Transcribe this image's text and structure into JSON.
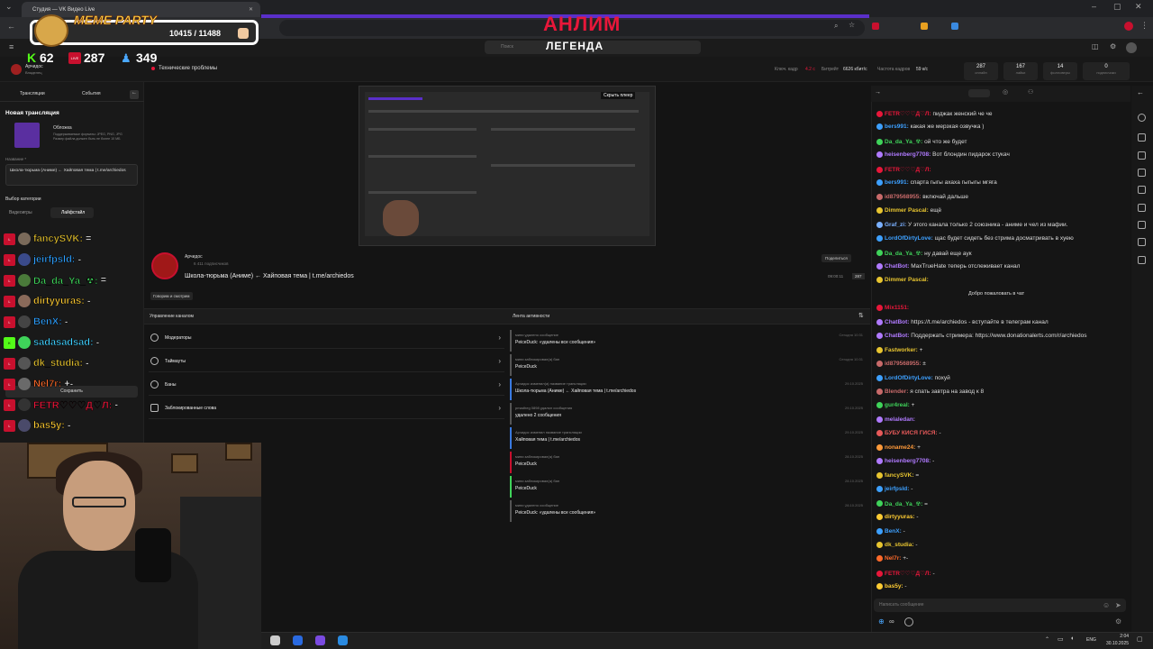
{
  "browser": {
    "tab_title": "Студия — VK Видео Live"
  },
  "overlay": {
    "title": "MEME PARTY",
    "counter": "10415 / 11488",
    "live_badge": "LIVE",
    "counts": {
      "kick": "62",
      "live": "287",
      "viewers": "349"
    },
    "brand": "АНЛИМ",
    "subtitle": "ЛЕГЕНДА"
  },
  "header": {
    "search_placeholder": "Поиск",
    "status_text": "Технические проблемы",
    "keyframe_label": "Ключ. кадр",
    "keyframe_value": "4.2 с",
    "bitrate_label": "Битрейт",
    "bitrate_value": "6626 кбит/с",
    "fps_label": "Частота кадров",
    "fps_value": "59 к/с",
    "stats": [
      {
        "v": "287",
        "l": "онлайн"
      },
      {
        "v": "167",
        "l": "лайки"
      },
      {
        "v": "14",
        "l": "фолловеры"
      },
      {
        "v": "0",
        "l": "подписчики"
      }
    ]
  },
  "profile": {
    "name": "Арчидос",
    "sub": "Владелец"
  },
  "left": {
    "tabs": [
      "Трансляции",
      "События"
    ],
    "new_stream": "Новая трансляция",
    "cover_label": "Обложка",
    "cover_hint": "Поддерживаемые форматы: JPEG, PNG, JPG Размер файла должен быть не более 10 МБ",
    "name_label": "Название *",
    "name_value": "Школа-тюрьма (Аниме) ← Хайповая тема | t.me/archiedos",
    "category_label": "Выбор категории",
    "cat_games": "Видеоигры",
    "cat_life": "Лайфстайл",
    "save_button": "Сохранить"
  },
  "viewers": [
    {
      "name": "fancySVK:",
      "msg": "=",
      "color": "#e8c530"
    },
    {
      "name": "jeirfpsld:",
      "msg": "-",
      "color": "#2ea0ff"
    },
    {
      "name": "Da_da_Ya_☢:",
      "msg": "=",
      "color": "#3fd35a"
    },
    {
      "name": "dirtyyuras:",
      "msg": "-",
      "color": "#ffcc33"
    },
    {
      "name": "BenX:",
      "msg": "-",
      "color": "#2ea0ff"
    },
    {
      "name": "sadasadsad:",
      "msg": "-",
      "color": "#40d0ff"
    },
    {
      "name": "dk_studia:",
      "msg": "-",
      "color": "#e8c530"
    },
    {
      "name": "Nel7r:",
      "msg": "+-",
      "color": "#ff6a2a"
    },
    {
      "name": "FETR♡♡♡Д♡Л:",
      "msg": "-",
      "color": "#e8173a"
    },
    {
      "name": "bas5y:",
      "msg": "-",
      "color": "#ffcc33"
    }
  ],
  "channel": {
    "name": "Арчидос",
    "subs": "6 411 подписчиков",
    "stream_title": "Школа-тюрьма (Аниме) ← Хайповая тема | t.me/archiedos",
    "category": "Говорим и смотрим",
    "share": "Поделиться",
    "time": "09:00:11",
    "viewers": "287",
    "hide_player": "Скрыть плеер"
  },
  "management": {
    "title": "Управление каналом",
    "items": [
      "Модераторы",
      "Таймауты",
      "Баны",
      "Заблокированные слова"
    ]
  },
  "activity": {
    "title": "Лента активности",
    "items": [
      {
        "t1": "мини удалено сообщение",
        "t2": "PeiceDuck: «удалены все сообщения»",
        "tm": "Сегодня 10:31"
      },
      {
        "t1": "мини заблокировал(а) бан",
        "t2": "PeiceDuck",
        "tm": "Сегодня 10:31"
      },
      {
        "t1": "Арчидос изменил(а) название трансляции",
        "t2": "Школа-тюрьма (Аниме) ← Хайповая тема | t.me/archiedos",
        "tm": "29.10.2025"
      },
      {
        "t1": "pmadheg 0898 удалил сообщения",
        "t2": "удалено 2 сообщения",
        "tm": "29.10.2025"
      },
      {
        "t1": "Арчидос изменил название трансляции",
        "t2": "Хайповая тема | t.me/archiedos",
        "tm": "29.10.2025"
      },
      {
        "t1": "мини заблокировал(а) бан",
        "t2": "PeiceDuck",
        "tm": "28.10.2025"
      },
      {
        "t1": "мини заблокировал(а) бан",
        "t2": "PeiceDuck",
        "tm": "28.10.2025"
      },
      {
        "t1": "мини удалено сообщение",
        "t2": "PeiceDuck: «удалены все сообщения»",
        "tm": "28.10.2025"
      }
    ]
  },
  "chat": {
    "lines": [
      {
        "u": "FETR♡♡♡Д♡Л:",
        "m": "пиджак женский че че",
        "c": "#e8173a"
      },
      {
        "u": "bers991:",
        "m": "какая же мерзкая озвучка )",
        "c": "#3da0ff"
      },
      {
        "u": "Da_da_Ya_☢:",
        "m": "ой что же будет",
        "c": "#3fd35a"
      },
      {
        "u": "heisenberg7708:",
        "m": "Вот блондин пидарок стукач",
        "c": "#b07aff"
      },
      {
        "u": "FETR♡♡♡Д♡Л:",
        "m": "",
        "c": "#e8173a"
      },
      {
        "u": "bers991:",
        "m": "спарта гыгы ахаха гыгыгы мгяга",
        "c": "#3da0ff"
      },
      {
        "u": "id879568955:",
        "m": "включай дальше",
        "c": "#c86a6a"
      },
      {
        "u": "Dimmer Pascal:",
        "m": "ещё",
        "c": "#e8c530"
      },
      {
        "u": "Graf_zi:",
        "m": "У этого канала только 2 союзника - аниме и чел из мафии.",
        "c": "#7ab0ff"
      },
      {
        "u": "LordOfDirtyLove:",
        "m": "щас будет сидеть без стрима досматривать в хуею",
        "c": "#3da0ff"
      },
      {
        "u": "Da_da_Ya_☢:",
        "m": "ну давай еще аук",
        "c": "#3fd35a"
      },
      {
        "u": "ChatBot:",
        "m": "MaxTrueHate теперь отслеживает канал",
        "c": "#b07aff"
      },
      {
        "u": "Dimmer Pascal:",
        "m": "",
        "c": "#e8c530"
      },
      {
        "u": "",
        "m": "Добро пожаловать в чат",
        "c": "#ddd"
      },
      {
        "u": "Mix1151:",
        "m": "",
        "c": "#e8173a"
      },
      {
        "u": "ChatBot:",
        "m": "https://t.me/archiedos - вступайте в телеграм канал",
        "c": "#b07aff"
      },
      {
        "u": "ChatBot:",
        "m": "Поддержать стримера: https://www.donationalerts.com/r/archiedos",
        "c": "#b07aff"
      },
      {
        "u": "Fastworker:",
        "m": "+",
        "c": "#e8c530"
      },
      {
        "u": "id879568955:",
        "m": "±",
        "c": "#c86a6a"
      },
      {
        "u": "LordOfDirtyLove:",
        "m": "похуй",
        "c": "#3da0ff"
      },
      {
        "u": "Blender:",
        "m": "я спать завтра на завод к 8",
        "c": "#c86a6a"
      },
      {
        "u": "gur4real:",
        "m": "+",
        "c": "#3fd35a"
      },
      {
        "u": "melaledan:",
        "m": "",
        "c": "#b07aff"
      },
      {
        "u": "БУБУ КИСЯ ГИСЯ:",
        "m": "-",
        "c": "#e85a5a"
      },
      {
        "u": "noname24:",
        "m": "+",
        "c": "#ff9a3a"
      },
      {
        "u": "heisenberg7708:",
        "m": "-",
        "c": "#b07aff"
      },
      {
        "u": "fancySVK:",
        "m": "=",
        "c": "#e8c530"
      },
      {
        "u": "jeirfpsld:",
        "m": "-",
        "c": "#3da0ff"
      },
      {
        "u": "Da_da_Ya_☢:",
        "m": "=",
        "c": "#3fd35a"
      },
      {
        "u": "dirtyyuras:",
        "m": "-",
        "c": "#ffcc33"
      },
      {
        "u": "BenX:",
        "m": "-",
        "c": "#3da0ff"
      },
      {
        "u": "dk_studia:",
        "m": "-",
        "c": "#e8c530"
      },
      {
        "u": "Nel7r:",
        "m": "+-",
        "c": "#ff6a2a"
      },
      {
        "u": "FETR♡♡♡Д♡Л:",
        "m": "-",
        "c": "#e8173a"
      },
      {
        "u": "bas5y:",
        "m": "-",
        "c": "#ffcc33"
      }
    ],
    "input_placeholder": "Написать сообщение"
  },
  "taskbar": {
    "lang": "ENG",
    "time": "2:04",
    "date": "30.10.2025"
  }
}
